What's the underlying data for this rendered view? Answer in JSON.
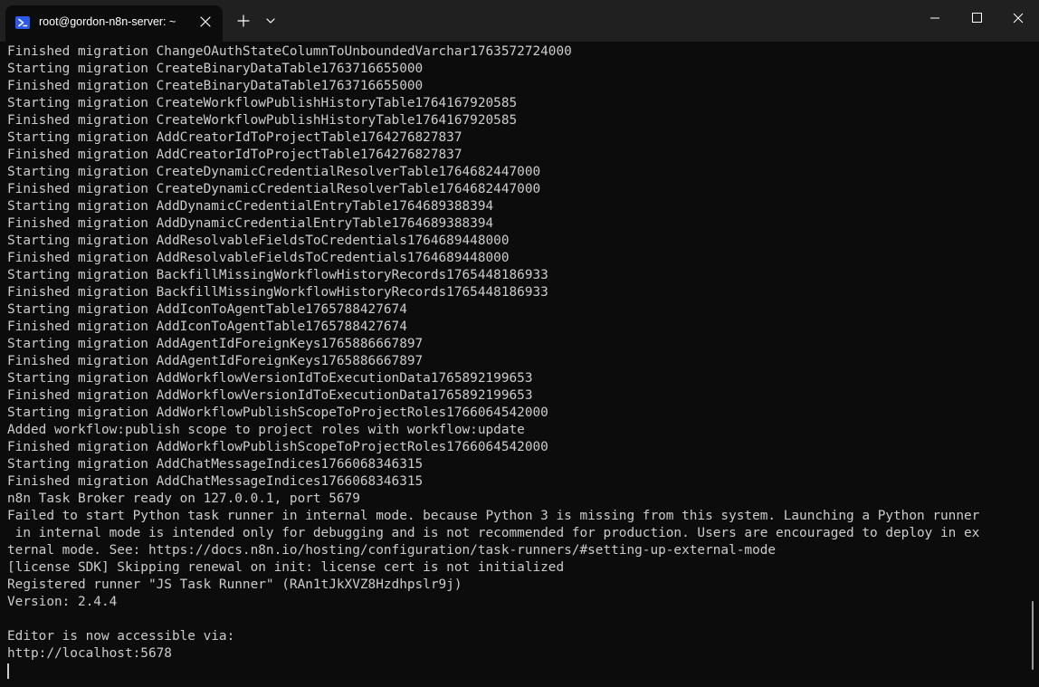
{
  "tab": {
    "title": "root@gordon-n8n-server: ~",
    "icon": "powershell-icon"
  },
  "titlebar": {
    "new_tab_icon": "plus-icon",
    "dropdown_icon": "chevron-down-icon",
    "minimize_icon": "minimize-icon",
    "maximize_icon": "maximize-icon",
    "close_icon": "close-icon"
  },
  "colors": {
    "background": "#0c0c0c",
    "titlebar": "#202020",
    "text": "#cccccc",
    "accent": "#2b5be8"
  },
  "terminal": {
    "lines": [
      "Finished migration ChangeOAuthStateColumnToUnboundedVarchar1763572724000",
      "Starting migration CreateBinaryDataTable1763716655000",
      "Finished migration CreateBinaryDataTable1763716655000",
      "Starting migration CreateWorkflowPublishHistoryTable1764167920585",
      "Finished migration CreateWorkflowPublishHistoryTable1764167920585",
      "Starting migration AddCreatorIdToProjectTable1764276827837",
      "Finished migration AddCreatorIdToProjectTable1764276827837",
      "Starting migration CreateDynamicCredentialResolverTable1764682447000",
      "Finished migration CreateDynamicCredentialResolverTable1764682447000",
      "Starting migration AddDynamicCredentialEntryTable1764689388394",
      "Finished migration AddDynamicCredentialEntryTable1764689388394",
      "Starting migration AddResolvableFieldsToCredentials1764689448000",
      "Finished migration AddResolvableFieldsToCredentials1764689448000",
      "Starting migration BackfillMissingWorkflowHistoryRecords1765448186933",
      "Finished migration BackfillMissingWorkflowHistoryRecords1765448186933",
      "Starting migration AddIconToAgentTable1765788427674",
      "Finished migration AddIconToAgentTable1765788427674",
      "Starting migration AddAgentIdForeignKeys1765886667897",
      "Finished migration AddAgentIdForeignKeys1765886667897",
      "Starting migration AddWorkflowVersionIdToExecutionData1765892199653",
      "Finished migration AddWorkflowVersionIdToExecutionData1765892199653",
      "Starting migration AddWorkflowPublishScopeToProjectRoles1766064542000",
      "Added workflow:publish scope to project roles with workflow:update",
      "Finished migration AddWorkflowPublishScopeToProjectRoles1766064542000",
      "Starting migration AddChatMessageIndices1766068346315",
      "Finished migration AddChatMessageIndices1766068346315",
      "n8n Task Broker ready on 127.0.0.1, port 5679",
      "Failed to start Python task runner in internal mode. because Python 3 is missing from this system. Launching a Python runner",
      " in internal mode is intended only for debugging and is not recommended for production. Users are encouraged to deploy in ex",
      "ternal mode. See: https://docs.n8n.io/hosting/configuration/task-runners/#setting-up-external-mode",
      "[license SDK] Skipping renewal on init: license cert is not initialized",
      "Registered runner \"JS Task Runner\" (RAn1tJkXVZ8Hzdhpslr9j)",
      "Version: 2.4.4",
      "",
      "Editor is now accessible via:",
      "http://localhost:5678"
    ]
  }
}
